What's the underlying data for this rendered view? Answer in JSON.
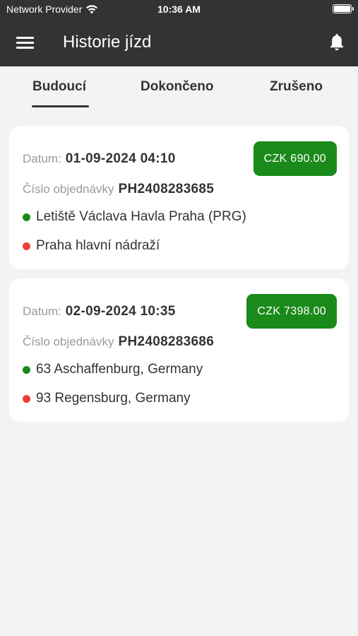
{
  "status_bar": {
    "carrier": "Network Provider",
    "time": "10:36 AM"
  },
  "app_bar": {
    "title": "Historie jízd",
    "menu_icon": "hamburger-menu-icon",
    "notification_icon": "bell-icon"
  },
  "tabs": [
    {
      "label": "Budoucí",
      "active": true
    },
    {
      "label": "Dokončeno",
      "active": false
    },
    {
      "label": "Zrušeno",
      "active": false
    }
  ],
  "labels": {
    "date": "Datum:",
    "order_number": "Číslo objednávky"
  },
  "rides": [
    {
      "date": "01-09-2024 04:10",
      "price": "CZK 690.00",
      "order_number": "PH2408283685",
      "pickup": "Letiště Václava Havla Praha (PRG)",
      "dropoff": "Praha hlavní nádraží"
    },
    {
      "date": "02-09-2024 10:35",
      "price": "CZK 7398.00",
      "order_number": "PH2408283686",
      "pickup": "63 Aschaffenburg, Germany",
      "dropoff": "93 Regensburg, Germany"
    }
  ],
  "colors": {
    "app_bar": "#333333",
    "background": "#f3f3f3",
    "price_badge": "#1a8a1a",
    "pickup_dot": "#1a8a1a",
    "dropoff_dot": "#ee3e35"
  }
}
